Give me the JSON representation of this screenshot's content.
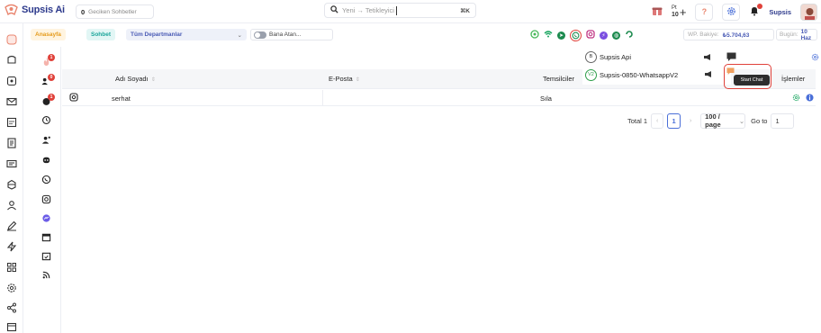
{
  "app": {
    "name": "Supsis Ai"
  },
  "topbar": {
    "late_chats_count": "0",
    "late_chats_label": "Geciken Sohbetler",
    "search_placeholder": "Yeni → Tetikleyici",
    "search_shortcut": "⌘K",
    "points_label": "Pt",
    "points_value": "10",
    "user_name": "Supsis"
  },
  "filterbar": {
    "home": "Anasayfa",
    "chat": "Sohbet",
    "department": "Tüm Departmanlar",
    "assigned_label": "Bana Atan...",
    "wp_balance_label": "WP. Bakiye:",
    "wp_balance_value": "₺5.704,63",
    "today_label": "Bugün:",
    "today_value": "10 Haz"
  },
  "table": {
    "columns": [
      "Adı Soyadı",
      "E-Posta",
      "Temsilciler",
      "İşlemler"
    ],
    "rows": [
      {
        "name": "serhat",
        "email": "",
        "agent": "Sıla"
      }
    ]
  },
  "pagination": {
    "total_label": "Total 1",
    "current_page": "1",
    "page_size": "100 / page",
    "goto_label": "Go to",
    "goto_value": "1"
  },
  "whatsapp_dropdown": {
    "items": [
      {
        "badge": "B",
        "label": "Supsis Api"
      },
      {
        "badge": "V2",
        "label": "Supsis-0850-WhatsappV2"
      }
    ]
  },
  "tooltip": {
    "text": "Start Chat"
  },
  "colors": {
    "accent": "#4a6fd8",
    "brand": "#2d3a8c",
    "alert": "#e0413a",
    "whatsapp": "#2e9e4a"
  },
  "icons": {
    "sidebar": [
      "logo-icon",
      "inbox-icon",
      "chat-icon",
      "mail-icon",
      "calculator-icon",
      "report-icon",
      "id-card-icon",
      "box-icon",
      "user-icon",
      "edit-icon",
      "bolt-icon",
      "apps-icon",
      "settings-icon",
      "share-icon",
      "calendar-icon"
    ],
    "subside": [
      "fire-icon",
      "team-icon",
      "alarm-icon",
      "history-icon",
      "user-group-icon",
      "bot-icon",
      "whatsapp-icon",
      "instagram-icon",
      "messenger-icon",
      "calendar-icon",
      "calendar-check-icon",
      "rss-icon"
    ]
  }
}
